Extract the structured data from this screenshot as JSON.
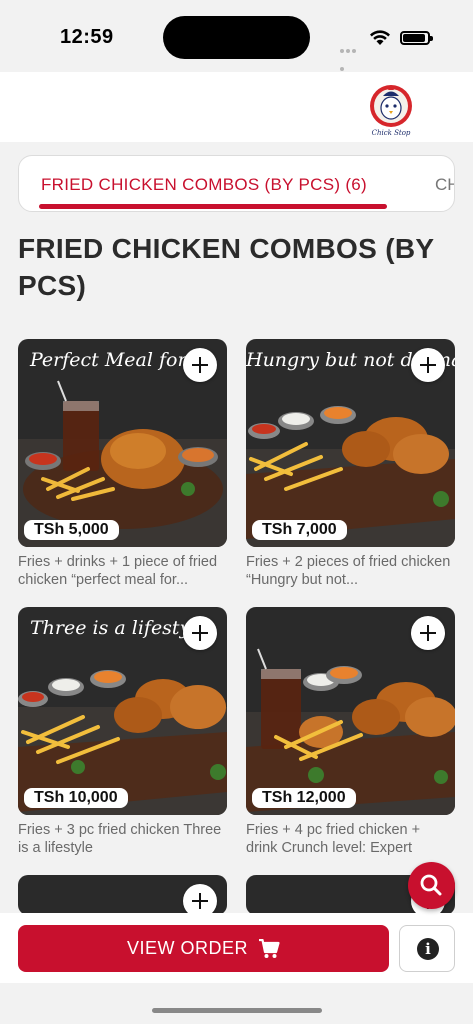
{
  "status_bar": {
    "time": "12:59"
  },
  "header": {
    "logo_text": "Chick Stop"
  },
  "tabs": [
    {
      "label": "FRIED CHICKEN COMBOS (BY PCS) (6)",
      "active": true
    },
    {
      "label": "CH",
      "active": false
    }
  ],
  "section": {
    "title": "FRIED CHICKEN COMBOS (BY PCS)"
  },
  "items": [
    {
      "banner": "Perfect Meal for o",
      "price": "TSh 5,000",
      "description": "Fries + drinks + 1 piece of fried chicken “perfect meal for..."
    },
    {
      "banner": "Hungry but not dramatic",
      "price": "TSh 7,000",
      "description": "Fries + 2 pieces of fried chicken “Hungry but not..."
    },
    {
      "banner": "Three is a lifestyle",
      "price": "TSh 10,000",
      "description": "Fries + 3 pc fried chicken Three is a lifestyle"
    },
    {
      "banner": "",
      "price": "TSh 12,000",
      "description": "Fries + 4 pc fried chicken + drink Crunch level: Expert"
    }
  ],
  "bottom_bar": {
    "view_order_label": "VIEW ORDER"
  },
  "colors": {
    "accent": "#c8102e",
    "background": "#f2f2f2"
  },
  "icons": [
    "search-icon",
    "cart-icon",
    "info-icon",
    "add-icon",
    "wifi-icon",
    "battery-icon"
  ]
}
